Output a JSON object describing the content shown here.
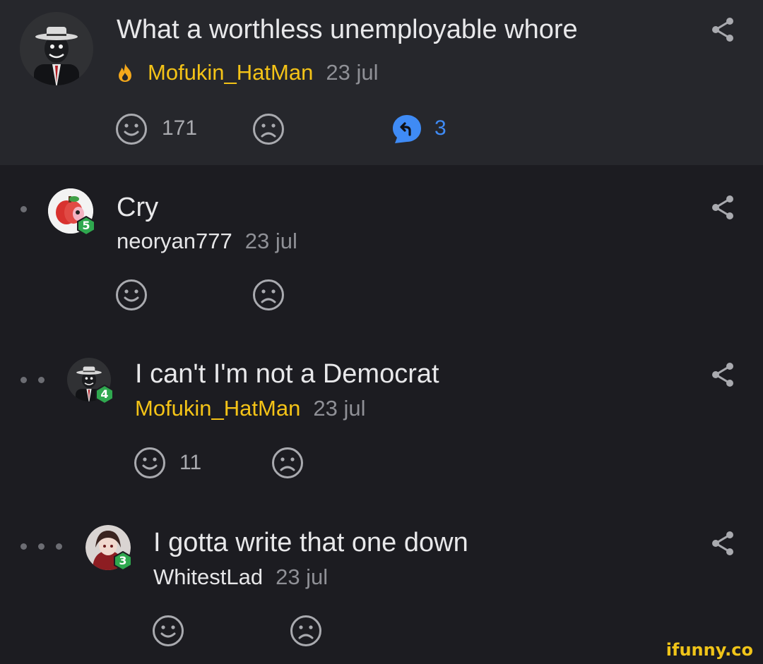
{
  "comments": [
    {
      "text": "What a worthless unemployable whore",
      "username": "Mofukin_HatMan",
      "date": "23 jul",
      "likes": "171",
      "replies": "3",
      "username_color": "#f4c317"
    },
    {
      "text": "Cry",
      "username": "neoryan777",
      "date": "23 jul",
      "level": "5"
    },
    {
      "text": "I can't I'm not a Democrat",
      "username": "Mofukin_HatMan",
      "date": "23 jul",
      "likes": "11",
      "level": "4",
      "username_color": "#f4c317"
    },
    {
      "text": "I gotta write that one down",
      "username": "WhitestLad",
      "date": "23 jul",
      "level": "3"
    }
  ],
  "icons": {
    "smile": "smile-icon",
    "unsmile": "unsmile-icon",
    "share": "share-icon",
    "reply": "reply-icon",
    "fire": "fire-icon"
  },
  "colors": {
    "accent_gold": "#f4c317",
    "reply_blue": "#3f8bf5",
    "level_green": "#2fa84f"
  },
  "watermark": "ifunny.co"
}
